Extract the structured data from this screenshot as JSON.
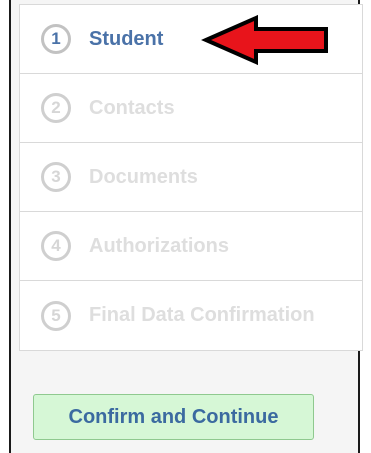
{
  "wizard": {
    "steps": [
      {
        "number": "1",
        "label": "Student",
        "state": "active"
      },
      {
        "number": "2",
        "label": "Contacts",
        "state": "disabled"
      },
      {
        "number": "3",
        "label": "Documents",
        "state": "disabled"
      },
      {
        "number": "4",
        "label": "Authorizations",
        "state": "disabled"
      },
      {
        "number": "5",
        "label": "Final Data Confirmation",
        "state": "disabled"
      }
    ],
    "confirm_label": "Confirm and Continue"
  },
  "annotation": {
    "arrow_icon": "red-left-arrow-icon",
    "arrow_color": "#e8141b"
  },
  "colors": {
    "active_text": "#4a72a8",
    "disabled_text": "#dedede",
    "button_bg": "#d6f7d6",
    "button_border": "#8fc98f"
  }
}
